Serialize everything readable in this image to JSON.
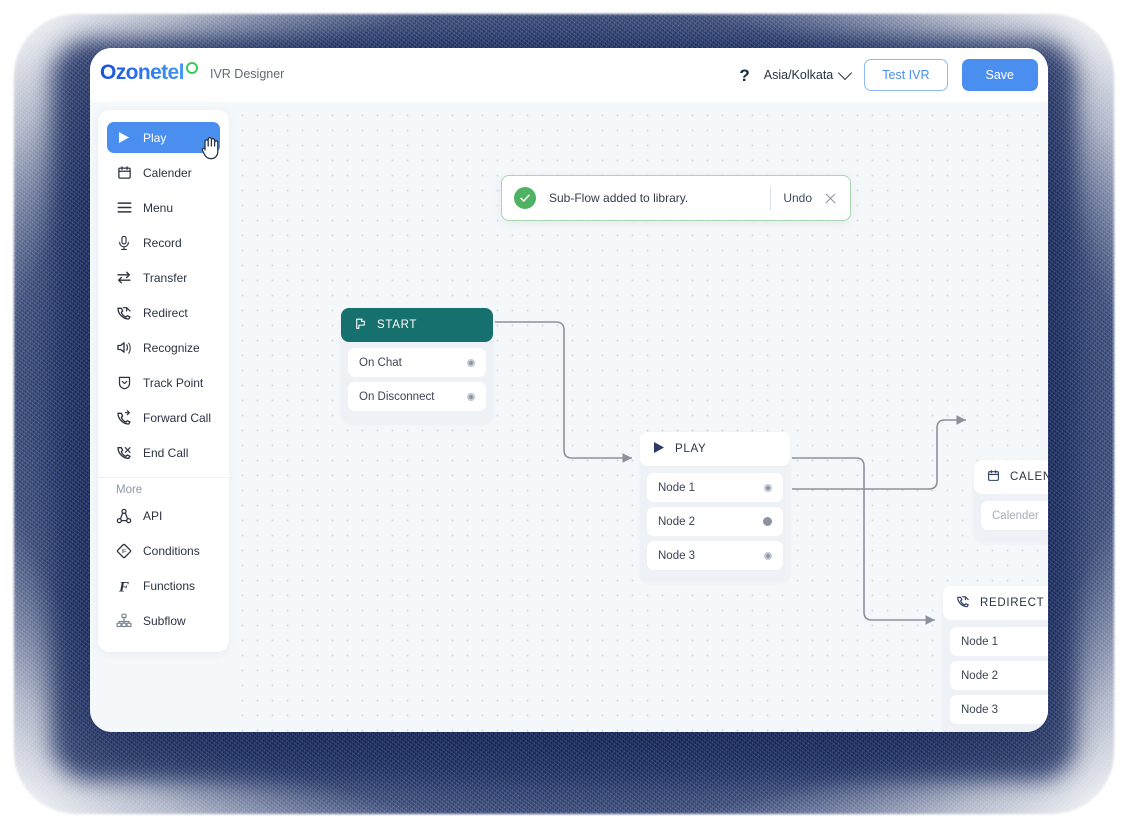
{
  "header": {
    "logo_text": "Ozonetel",
    "logo_mark": "green-circle",
    "app_title": "IVR Designer",
    "help_label": "?",
    "timezone": "Asia/Kolkata",
    "test_button": "Test IVR",
    "save_button": "Save",
    "accent_color": "#4a8ef0"
  },
  "sidebar": {
    "items": [
      {
        "label": "Play",
        "icon": "play-icon",
        "active": true
      },
      {
        "label": "Calender",
        "icon": "calendar-icon",
        "active": false
      },
      {
        "label": "Menu",
        "icon": "menu-icon",
        "active": false
      },
      {
        "label": "Record",
        "icon": "microphone-icon",
        "active": false
      },
      {
        "label": "Transfer",
        "icon": "transfer-arrows-icon",
        "active": false
      },
      {
        "label": "Redirect",
        "icon": "phone-redirect-icon",
        "active": false
      },
      {
        "label": "Recognize",
        "icon": "speaker-icon",
        "active": false
      },
      {
        "label": "Track Point",
        "icon": "shield-chevron-icon",
        "active": false
      },
      {
        "label": "Forward Call",
        "icon": "phone-forward-icon",
        "active": false
      },
      {
        "label": "End Call",
        "icon": "phone-end-icon",
        "active": false
      }
    ],
    "more_label": "More",
    "more_items": [
      {
        "label": "API",
        "icon": "api-node-icon"
      },
      {
        "label": "Conditions",
        "icon": "condition-diamond-icon"
      },
      {
        "label": "Functions",
        "icon": "function-f-icon"
      },
      {
        "label": "Subflow",
        "icon": "subflow-tree-icon"
      }
    ]
  },
  "toast": {
    "message": "Sub-Flow added to library.",
    "undo_label": "Undo",
    "icon": "check-circle-icon",
    "close_icon": "close-icon",
    "accent_color": "#4fb263"
  },
  "flow": {
    "nodes": [
      {
        "id": "start",
        "title": "START",
        "icon": "flag-icon",
        "header_style": "teal",
        "header_color": "#16706E",
        "rows": [
          {
            "label": "On Chat",
            "port": "connected"
          },
          {
            "label": "On Disconnect",
            "port": "open"
          }
        ]
      },
      {
        "id": "play",
        "title": "PLAY",
        "icon": "play-icon",
        "header_style": "white",
        "rows": [
          {
            "label": "Node 1",
            "port": "connected"
          },
          {
            "label": "Node 2",
            "port": "connected"
          },
          {
            "label": "Node 3",
            "port": "open"
          }
        ]
      },
      {
        "id": "calendar",
        "title": "CALENDAR",
        "icon": "calendar-icon",
        "header_style": "white",
        "rows": [
          {
            "label": "Calender",
            "port": "open",
            "placeholder": true
          }
        ]
      },
      {
        "id": "redirect",
        "title": "REDIRECT",
        "icon": "phone-redirect-icon",
        "header_style": "white",
        "rows": [
          {
            "label": "Node 1",
            "port": "open"
          },
          {
            "label": "Node 2",
            "port": "connected"
          },
          {
            "label": "Node 3",
            "port": "open"
          }
        ]
      }
    ],
    "edges": [
      {
        "from": "start.On Chat",
        "to": "play.input"
      },
      {
        "from": "play.Node 1",
        "to": "redirect.Node 2"
      },
      {
        "from": "play.Node 2",
        "to": "calendar.input"
      }
    ],
    "edge_color": "#8b929d"
  },
  "canvas": {
    "background_color": "#f5f8fb",
    "grid": "dotted"
  }
}
